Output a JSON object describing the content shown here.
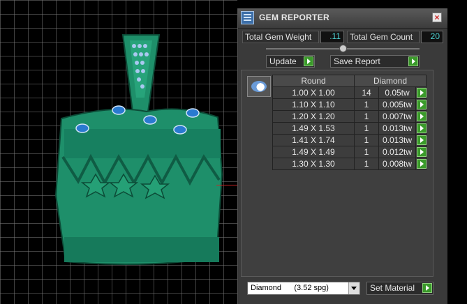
{
  "window": {
    "title": "GEM REPORTER"
  },
  "summary": {
    "weight_label": "Total Gem Weight",
    "weight_value": ".11",
    "count_label": "Total Gem Count",
    "count_value": "20"
  },
  "toolbar": {
    "update_label": "Update",
    "save_label": "Save Report"
  },
  "table": {
    "headers": [
      "Round",
      "Diamond"
    ],
    "rows": [
      {
        "size": "1.00 X 1.00",
        "count": "14",
        "tw": "0.05tw"
      },
      {
        "size": "1.10 X 1.10",
        "count": "1",
        "tw": "0.005tw"
      },
      {
        "size": "1.20 X 1.20",
        "count": "1",
        "tw": "0.007tw"
      },
      {
        "size": "1.49 X 1.53",
        "count": "1",
        "tw": "0.013tw"
      },
      {
        "size": "1.41 X 1.74",
        "count": "1",
        "tw": "0.013tw"
      },
      {
        "size": "1.49 X 1.49",
        "count": "1",
        "tw": "0.012tw"
      },
      {
        "size": "1.30 X 1.30",
        "count": "1",
        "tw": "0.008tw"
      }
    ]
  },
  "footer": {
    "material_selected": "Diamond      (3.52 spg)",
    "set_material_label": "Set Material"
  },
  "colors": {
    "model_green": "#1e8f6a",
    "accent_cyan": "#4fd6d6",
    "play_green": "#3a9a2a"
  }
}
